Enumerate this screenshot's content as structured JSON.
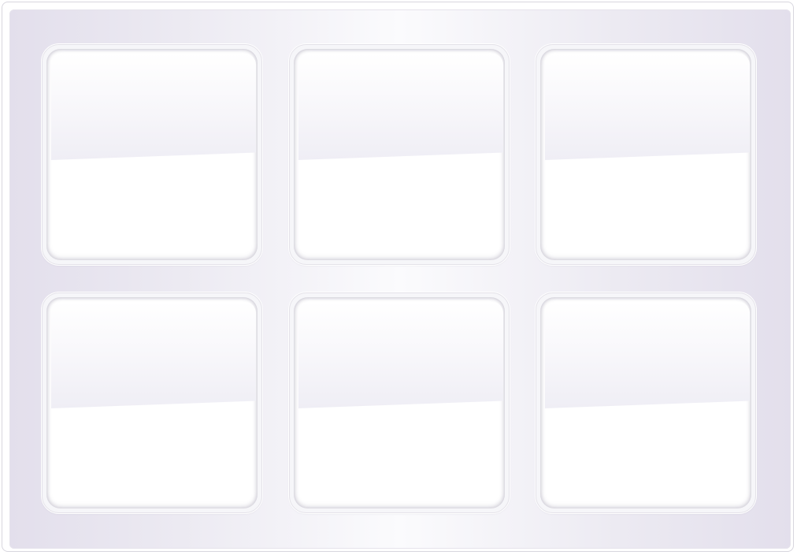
{
  "window": {
    "accent_color": "#e3dfec",
    "panel_color": "#fbfbfd"
  },
  "grid": {
    "rows": 2,
    "columns": 3,
    "tiles": [
      {
        "id": "tile-1",
        "label": ""
      },
      {
        "id": "tile-2",
        "label": ""
      },
      {
        "id": "tile-3",
        "label": ""
      },
      {
        "id": "tile-4",
        "label": ""
      },
      {
        "id": "tile-5",
        "label": ""
      },
      {
        "id": "tile-6",
        "label": ""
      }
    ]
  }
}
